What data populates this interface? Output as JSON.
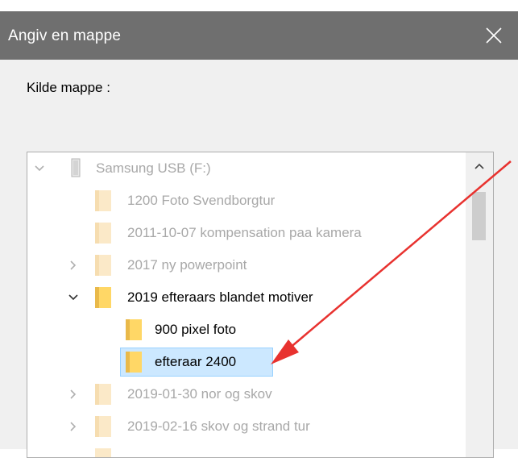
{
  "dialog": {
    "title": "Angiv en mappe",
    "close_glyph": "✕",
    "source_label": "Kilde mappe :"
  },
  "tree": {
    "items": [
      {
        "label": "Samsung USB (F:)",
        "icon": "usb-drive-icon",
        "chevron": "expanded",
        "state": "dimmed"
      },
      {
        "label": "1200 Foto Svendborgtur",
        "icon": "folder-icon",
        "chevron": "none",
        "state": "dimmed"
      },
      {
        "label": "2011-10-07 kompensation paa kamera",
        "icon": "folder-icon",
        "chevron": "none",
        "state": "dimmed"
      },
      {
        "label": "2017 ny powerpoint",
        "icon": "folder-icon",
        "chevron": "collapsed",
        "state": "dimmed"
      },
      {
        "label": "2019 efteraars blandet motiver",
        "icon": "folder-icon",
        "chevron": "expanded",
        "state": "active"
      },
      {
        "label": "900 pixel foto",
        "icon": "folder-icon",
        "chevron": "none",
        "state": "active"
      },
      {
        "label": "efteraar 2400",
        "icon": "folder-icon",
        "chevron": "none",
        "state": "selected"
      },
      {
        "label": "2019-01-30 nor og skov",
        "icon": "folder-icon",
        "chevron": "collapsed",
        "state": "dimmed"
      },
      {
        "label": "2019-02-16 skov og strand tur",
        "icon": "folder-icon",
        "chevron": "collapsed",
        "state": "dimmed"
      }
    ]
  },
  "colors": {
    "titlebar": "#6f6f6f",
    "selection_fill": "#cce8ff",
    "selection_border": "#99d1ff",
    "folder_active": "#ffd766",
    "folder_dim": "#fbe9c8",
    "annotation_arrow": "#e8322f"
  },
  "annotation": {
    "type": "red-arrow",
    "target": "efteraar 2400"
  }
}
